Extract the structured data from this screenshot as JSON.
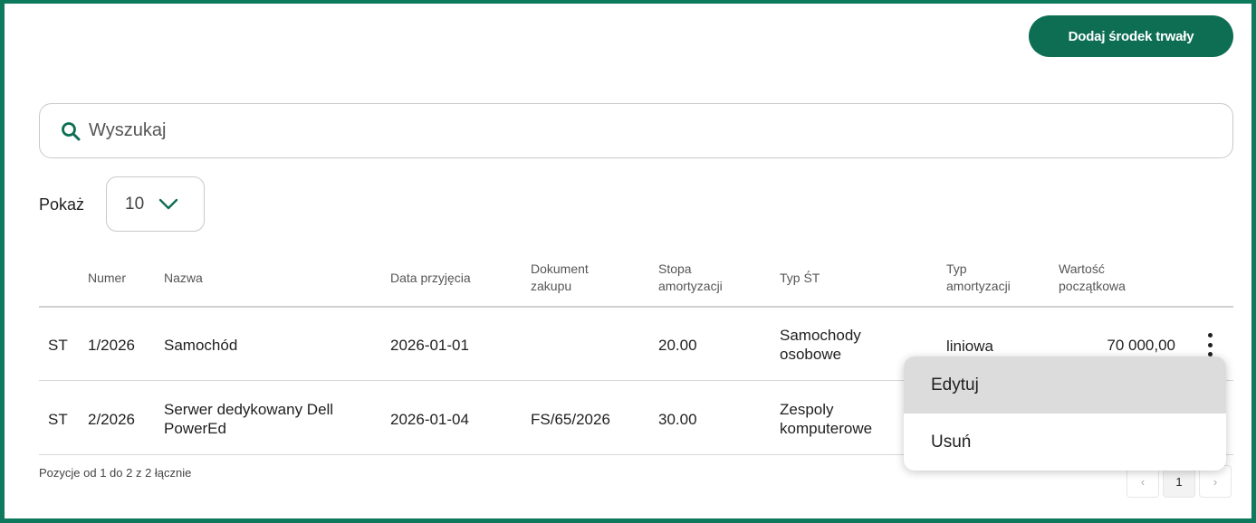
{
  "toolbar": {
    "add_label": "Dodaj środek trwały"
  },
  "search": {
    "placeholder": "Wyszukaj",
    "value": ""
  },
  "page_size": {
    "label": "Pokaż",
    "value": "10"
  },
  "table": {
    "headers": {
      "numer": "Numer",
      "nazwa": "Nazwa",
      "data": "Data przyjęcia",
      "dokument_1": "Dokument",
      "dokument_2": "zakupu",
      "stopa_1": "Stopa",
      "stopa_2": "amortyzacji",
      "typ_st": "Typ ŚT",
      "typ_am_1": "Typ",
      "typ_am_2": "amortyzacji",
      "wartosc_1": "Wartość",
      "wartosc_2": "początkowa"
    },
    "rows": [
      {
        "prefix": "ST",
        "numer": "1/2026",
        "nazwa_1": "Samochód",
        "nazwa_2": "",
        "data": "2026-01-01",
        "dokument": "",
        "stopa": "20.00",
        "typ_st_1": "Samochody",
        "typ_st_2": "osobowe",
        "typ_am": "liniowa",
        "wartosc": "70 000,00"
      },
      {
        "prefix": "ST",
        "numer": "2/2026",
        "nazwa_1": "Serwer dedykowany Dell",
        "nazwa_2": "PowerEd",
        "data": "2026-01-04",
        "dokument": "FS/65/2026",
        "stopa": "30.00",
        "typ_st_1": "Zespoly",
        "typ_st_2": "komputerowe",
        "typ_am": "",
        "wartosc": ""
      }
    ]
  },
  "context_menu": {
    "items": [
      "Edytuj",
      "Usuń"
    ]
  },
  "footer": {
    "summary": "Pozycje od 1 do 2 z 2 łącznie"
  },
  "pagination": {
    "prev": "‹",
    "current": "1",
    "next": "›"
  },
  "colors": {
    "brand": "#0d6e53",
    "border": "#0d7a5e"
  },
  "icons": [
    "search-icon",
    "chevron-down-icon",
    "more-vertical-icon"
  ]
}
